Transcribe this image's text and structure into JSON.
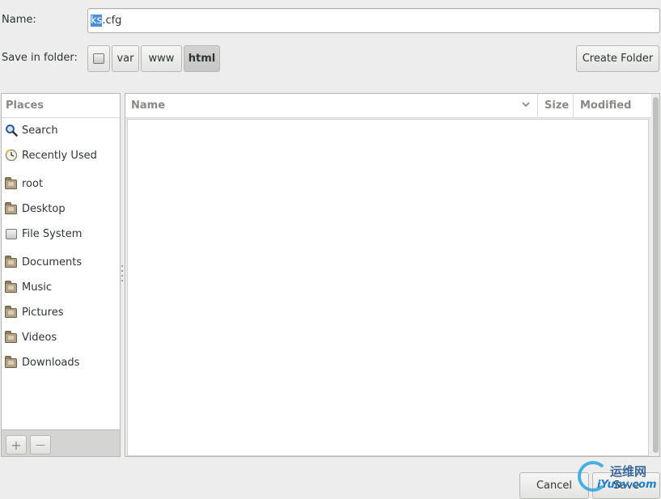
{
  "name_row": {
    "label": "Name:",
    "value_selected": "ks",
    "value_rest": ".cfg"
  },
  "folder_row": {
    "label": "Save in folder:",
    "crumbs": [
      "var",
      "www",
      "html"
    ],
    "active_crumb": "html",
    "create_folder_label": "Create Folder"
  },
  "places": {
    "header": "Places",
    "items": [
      {
        "label": "Search",
        "icon": "search-icon"
      },
      {
        "label": "Recently Used",
        "icon": "clock-icon"
      },
      {
        "label": "root",
        "icon": "home-folder-icon"
      },
      {
        "label": "Desktop",
        "icon": "desktop-folder-icon"
      },
      {
        "label": "File System",
        "icon": "drive-icon"
      },
      {
        "label": "Documents",
        "icon": "documents-folder-icon"
      },
      {
        "label": "Music",
        "icon": "music-folder-icon"
      },
      {
        "label": "Pictures",
        "icon": "pictures-folder-icon"
      },
      {
        "label": "Videos",
        "icon": "videos-folder-icon"
      },
      {
        "label": "Downloads",
        "icon": "downloads-folder-icon"
      }
    ],
    "add_glyph": "+",
    "remove_glyph": "—"
  },
  "file_list": {
    "columns": [
      "Name",
      "Size",
      "Modified"
    ],
    "sort_glyph": "❯"
  },
  "buttons": {
    "cancel": "Cancel",
    "save": "Save"
  },
  "watermark": {
    "cn_text": "运维网",
    "en_text": "iYunv.com"
  },
  "colors": {
    "selection": "#4a90d9",
    "watermark_blue": "#2aa6e0"
  }
}
